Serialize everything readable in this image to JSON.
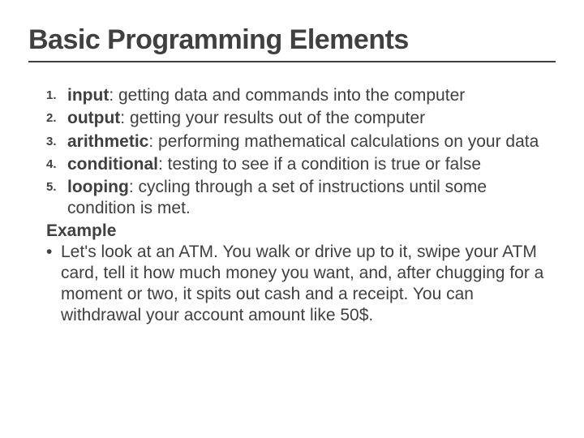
{
  "title": "Basic Programming Elements",
  "items": [
    {
      "num": "1.",
      "term": "input",
      "desc": ": getting data and commands into the computer"
    },
    {
      "num": "2.",
      "term": "output",
      "desc": ": getting your results out of the computer"
    },
    {
      "num": "3.",
      "term": "arithmetic",
      "desc": ": performing mathematical calculations on your data"
    },
    {
      "num": "4.",
      "term": "conditional",
      "desc": ": testing to see if a condition is true or false"
    },
    {
      "num": "5.",
      "term": "looping",
      "desc": ": cycling through a set of instructions until some condition is met."
    }
  ],
  "example_label": "Example",
  "bullet": "•",
  "example_text": "Let's look at an ATM. You walk or drive up to it, swipe your ATM card, tell it how much money you want, and, after chugging for a moment or two, it spits out cash and a receipt. You can withdrawal your account  amount like 50$."
}
